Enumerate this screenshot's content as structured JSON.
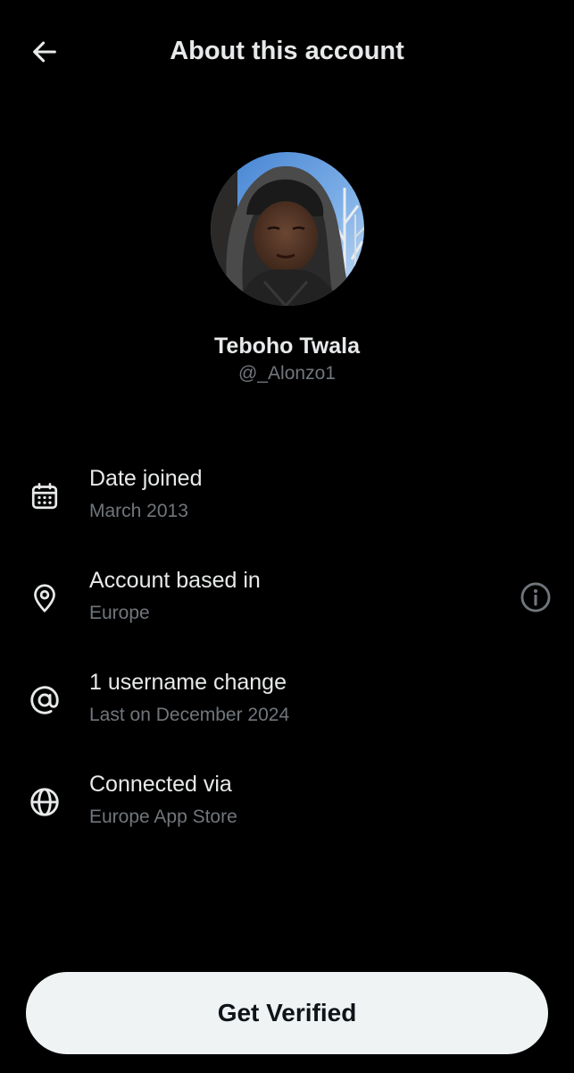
{
  "header": {
    "title": "About this account",
    "back_icon": "arrow-left-icon"
  },
  "profile": {
    "display_name": "Teboho Twala",
    "handle": "@_Alonzo1",
    "avatar": "profile-photo"
  },
  "details": [
    {
      "icon": "calendar-icon",
      "label": "Date joined",
      "value": "March 2013"
    },
    {
      "icon": "location-pin-icon",
      "label": "Account based in",
      "value": "Europe",
      "trailing_icon": "info-circle-icon"
    },
    {
      "icon": "at-sign-icon",
      "label": "1 username change",
      "value": "Last on December 2024"
    },
    {
      "icon": "globe-icon",
      "label": "Connected via",
      "value": "Europe App Store"
    }
  ],
  "cta": {
    "label": "Get Verified"
  },
  "colors": {
    "background": "#000000",
    "primary_text": "#e7e9ea",
    "secondary_text": "#71767b",
    "button_bg": "#eff3f4",
    "button_text": "#0f1419"
  }
}
